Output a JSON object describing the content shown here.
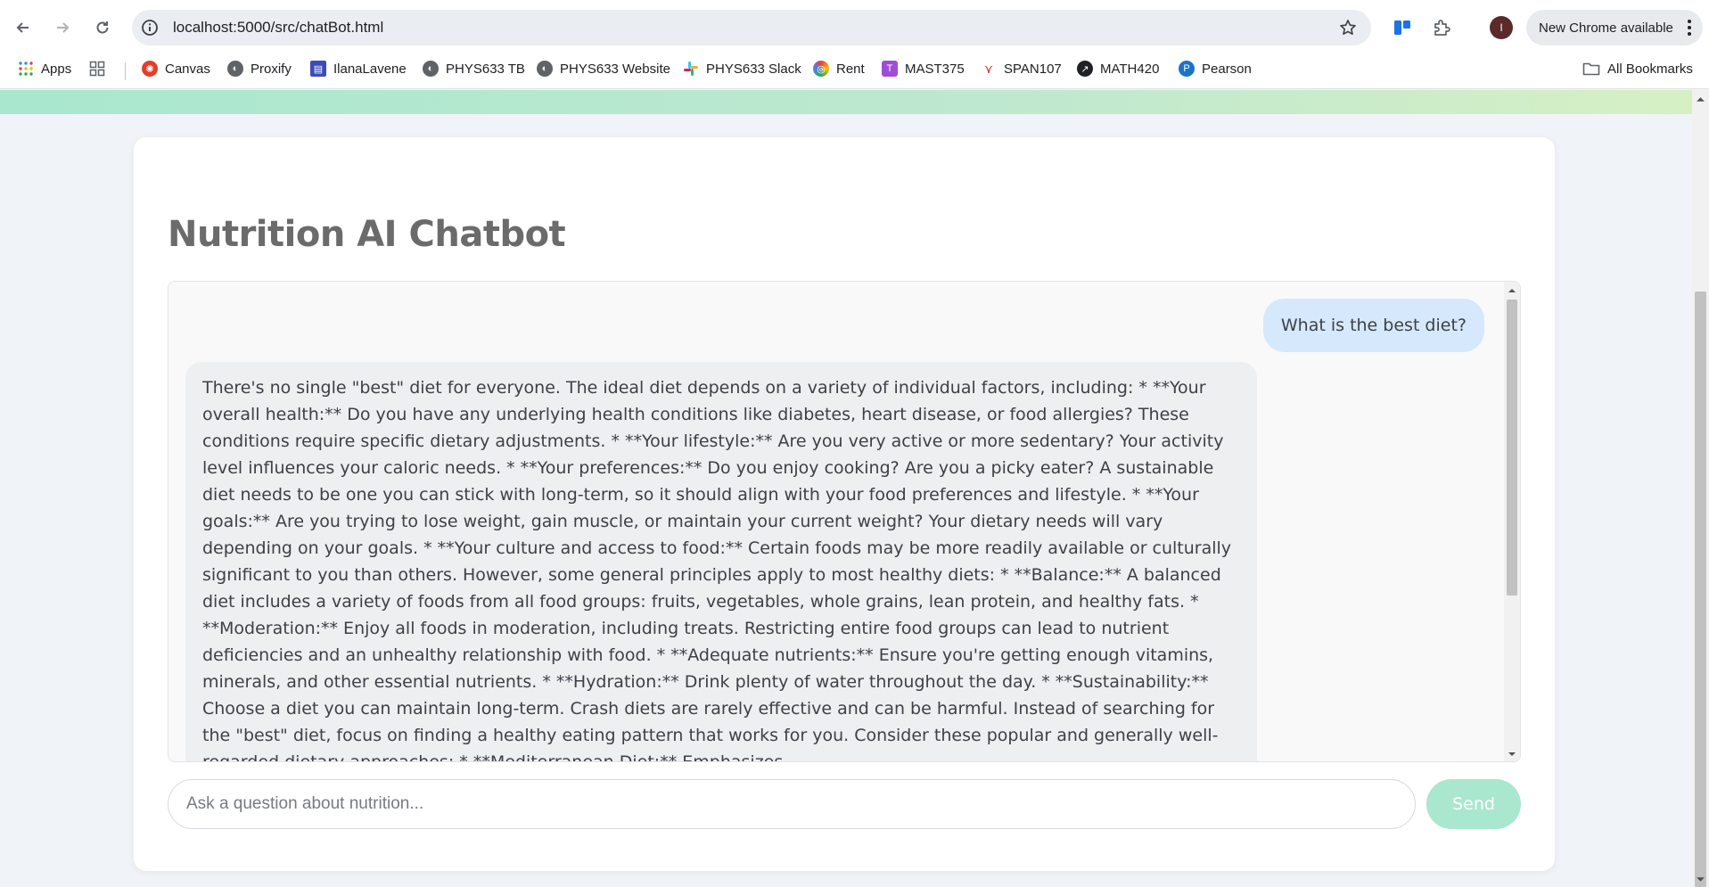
{
  "browser": {
    "url": "localhost:5000/src/chatBot.html",
    "avatar_letter": "I",
    "update_label": "New Chrome available",
    "bookmarks": [
      {
        "label": "Apps",
        "icon": "apps-grid-icon",
        "color": "#4285f4"
      },
      {
        "label": "Canvas",
        "icon": "canvas-icon",
        "color": "#e13f2b"
      },
      {
        "label": "Proxify",
        "icon": "globe-icon",
        "color": "#5f6368"
      },
      {
        "label": "IlanaLavene",
        "icon": "page-icon",
        "color": "#3b4cb8"
      },
      {
        "label": "PHYS633 TB",
        "icon": "globe-icon",
        "color": "#5f6368"
      },
      {
        "label": "PHYS633 Website",
        "icon": "globe-icon",
        "color": "#5f6368"
      },
      {
        "label": "PHYS633 Slack",
        "icon": "slack-icon",
        "color": "#e01e5a"
      },
      {
        "label": "Rent",
        "icon": "rent-icon",
        "color": "#ea4335"
      },
      {
        "label": "MAST375",
        "icon": "mast-icon",
        "color": "#a04dd6"
      },
      {
        "label": "SPAN107",
        "icon": "span-icon",
        "color": "#d93025"
      },
      {
        "label": "MATH420",
        "icon": "math-icon",
        "color": "#202124"
      },
      {
        "label": "Pearson",
        "icon": "pearson-icon",
        "color": "#1a73c8"
      }
    ],
    "all_bookmarks_label": "All Bookmarks"
  },
  "page": {
    "title": "Nutrition AI Chatbot",
    "messages": [
      {
        "role": "user",
        "text": "What is the best diet?"
      },
      {
        "role": "bot",
        "text": "There's no single \"best\" diet for everyone. The ideal diet depends on a variety of individual factors, including: * **Your overall health:** Do you have any underlying health conditions like diabetes, heart disease, or food allergies? These conditions require specific dietary adjustments. * **Your lifestyle:** Are you very active or more sedentary? Your activity level influences your caloric needs. * **Your preferences:** Do you enjoy cooking? Are you a picky eater? A sustainable diet needs to be one you can stick with long-term, so it should align with your food preferences and lifestyle. * **Your goals:** Are you trying to lose weight, gain muscle, or maintain your current weight? Your dietary needs will vary depending on your goals. * **Your culture and access to food:** Certain foods may be more readily available or culturally significant to you than others. However, some general principles apply to most healthy diets: * **Balance:** A balanced diet includes a variety of foods from all food groups: fruits, vegetables, whole grains, lean protein, and healthy fats. * **Moderation:** Enjoy all foods in moderation, including treats. Restricting entire food groups can lead to nutrient deficiencies and an unhealthy relationship with food. * **Adequate nutrients:** Ensure you're getting enough vitamins, minerals, and other essential nutrients. * **Hydration:** Drink plenty of water throughout the day. * **Sustainability:** Choose a diet you can maintain long-term. Crash diets are rarely effective and can be harmful. Instead of searching for the \"best\" diet, focus on finding a healthy eating pattern that works for you. Consider these popular and generally well-regarded dietary approaches: * **Mediterranean Diet:** Emphasizes"
      }
    ],
    "input_placeholder": "Ask a question about nutrition...",
    "input_value": "",
    "send_label": "Send",
    "accent_color": "#a9e7cf"
  }
}
